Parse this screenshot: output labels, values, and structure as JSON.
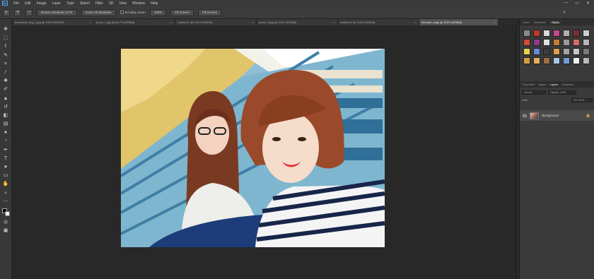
{
  "app": {
    "logo": "Ps"
  },
  "menubar": {
    "items": [
      "File",
      "Edit",
      "Image",
      "Layer",
      "Type",
      "Select",
      "Filter",
      "3D",
      "View",
      "Window",
      "Help"
    ]
  },
  "window_controls": {
    "minimize": "—",
    "restore": "▭",
    "close": "✕"
  },
  "options_bar": {
    "btn1": "Resize Windows to Fit",
    "btn2": "Zoom All Windows",
    "check_label": "Scrubby Zoom",
    "btn3": "100%",
    "btn4": "Fit Screen",
    "btn5": "Fill Screen"
  },
  "tabs": [
    {
      "label": "thumbnail_img_1.jpg @ 100% (RGB/8)",
      "active": false
    },
    {
      "label": "photo_2.jpg @ 66.7% (RGB/8)",
      "active": false
    },
    {
      "label": "Untitled-1 @ 100% (RGB/8)",
      "active": false
    },
    {
      "label": "photo_3.jpg @ 100% (RGB/8)",
      "active": false
    },
    {
      "label": "Untitled-2 @ 100% (RGB/8)",
      "active": false
    },
    {
      "label": "hinhanh_copy @ 100% (RGB/8)",
      "active": true
    }
  ],
  "right_panel": {
    "tabs": [
      "Color",
      "Swatches",
      "Styles"
    ],
    "active_tab": "Styles",
    "style_colors": [
      "#8a8a8a",
      "#c0392b",
      "#d9d9d9",
      "#c24b8a",
      "#b0b0b0",
      "#7b2f2f",
      "#cfcfcf",
      "#d24a3a",
      "#8f3a8f",
      "#e0e0e0",
      "#c77c2e",
      "#9a9a9a",
      "#d46b6b",
      "#b6b6b6",
      "#e6d34a",
      "#6a8ad8",
      "#3c3c3c",
      "#d8a050",
      "#a6a6a6",
      "#c8c8c8",
      "#7a7a7a",
      "#d0a040",
      "#e2b060",
      "#9a7040",
      "#a8c8e8",
      "#6fa0d8",
      "#f0f0f0",
      "#b9b9b9"
    ]
  },
  "layers_panel": {
    "tabs": [
      "Properties",
      "Adjust",
      "Layers",
      "Channels"
    ],
    "active_tab": "Layers",
    "blend_mode": "Normal",
    "opacity": "Opacity: 100%",
    "lock": "Lock:",
    "fill": "Fill: 100%",
    "layer_name": "Background"
  },
  "icons": {
    "tools": [
      "move-icon",
      "marquee-icon",
      "lasso-icon",
      "quick-select-icon",
      "crop-icon",
      "eyedropper-icon",
      "healing-icon",
      "brush-icon",
      "clone-stamp-icon",
      "history-brush-icon",
      "eraser-icon",
      "gradient-icon",
      "blur-icon",
      "dodge-icon",
      "pen-icon",
      "type-icon",
      "path-select-icon",
      "shape-icon",
      "hand-icon",
      "zoom-icon",
      "more-icon"
    ]
  }
}
